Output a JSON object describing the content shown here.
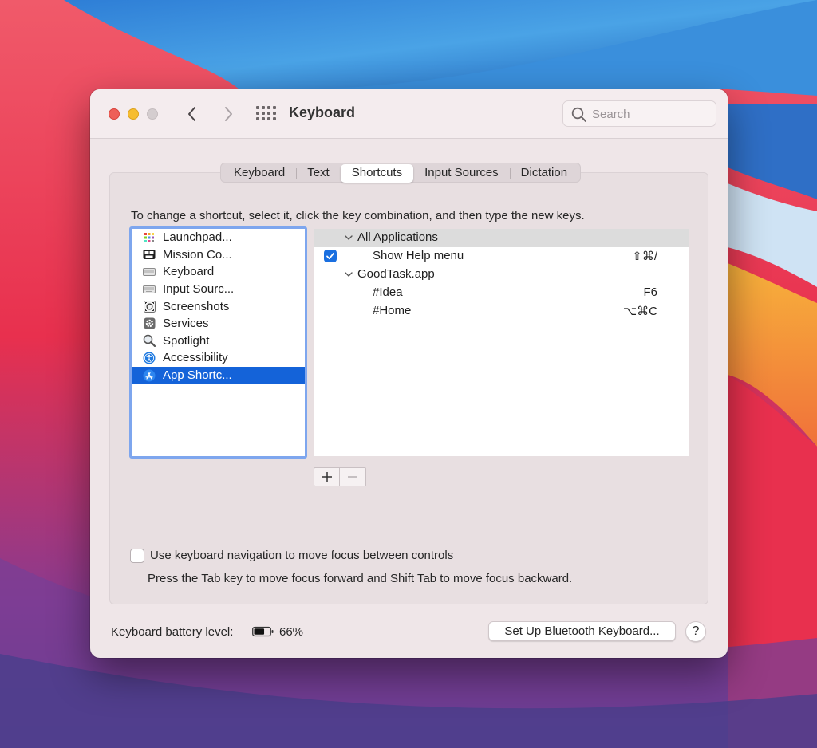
{
  "window": {
    "title": "Keyboard",
    "search_placeholder": "Search"
  },
  "tabs": [
    {
      "label": "Keyboard",
      "active": false
    },
    {
      "label": "Text",
      "active": false
    },
    {
      "label": "Shortcuts",
      "active": true
    },
    {
      "label": "Input Sources",
      "active": false
    },
    {
      "label": "Dictation",
      "active": false
    }
  ],
  "instruction": "To change a shortcut, select it, click the key combination, and then type the new keys.",
  "categories": [
    {
      "label": "Launchpad...",
      "icon": "launchpad-icon"
    },
    {
      "label": "Mission Co...",
      "icon": "mission-control-icon"
    },
    {
      "label": "Keyboard",
      "icon": "keyboard-icon"
    },
    {
      "label": "Input Sourc...",
      "icon": "input-sources-icon"
    },
    {
      "label": "Screenshots",
      "icon": "screenshots-icon"
    },
    {
      "label": "Services",
      "icon": "services-gear-icon"
    },
    {
      "label": "Spotlight",
      "icon": "spotlight-magnifier-icon"
    },
    {
      "label": "Accessibility",
      "icon": "accessibility-icon"
    },
    {
      "label": "App Shortc...",
      "icon": "app-store-icon",
      "selected": true
    }
  ],
  "shortcuts": {
    "groups": [
      {
        "label": "All Applications",
        "items": [
          {
            "label": "Show Help menu",
            "key": "⇧⌘/",
            "checked": true
          }
        ]
      },
      {
        "label": "GoodTask.app",
        "items": [
          {
            "label": "#Idea",
            "key": "F6"
          },
          {
            "label": "#Home",
            "key": "⌥⌘C"
          }
        ]
      }
    ]
  },
  "buttons": {
    "plus": "+",
    "minus": "−",
    "bluetooth": "Set Up Bluetooth Keyboard...",
    "help": "?"
  },
  "keyboard_navigation": {
    "label": "Use keyboard navigation to move focus between controls",
    "description": "Press the Tab key to move focus forward and Shift Tab to move focus backward.",
    "checked": false
  },
  "battery": {
    "label": "Keyboard battery level:",
    "percent": "66%",
    "level": 0.66
  },
  "colors": {
    "accent": "#1463d9",
    "selection_focus": "#7ea6ee",
    "close": "#ee5f58",
    "minimize": "#f6bd30"
  }
}
